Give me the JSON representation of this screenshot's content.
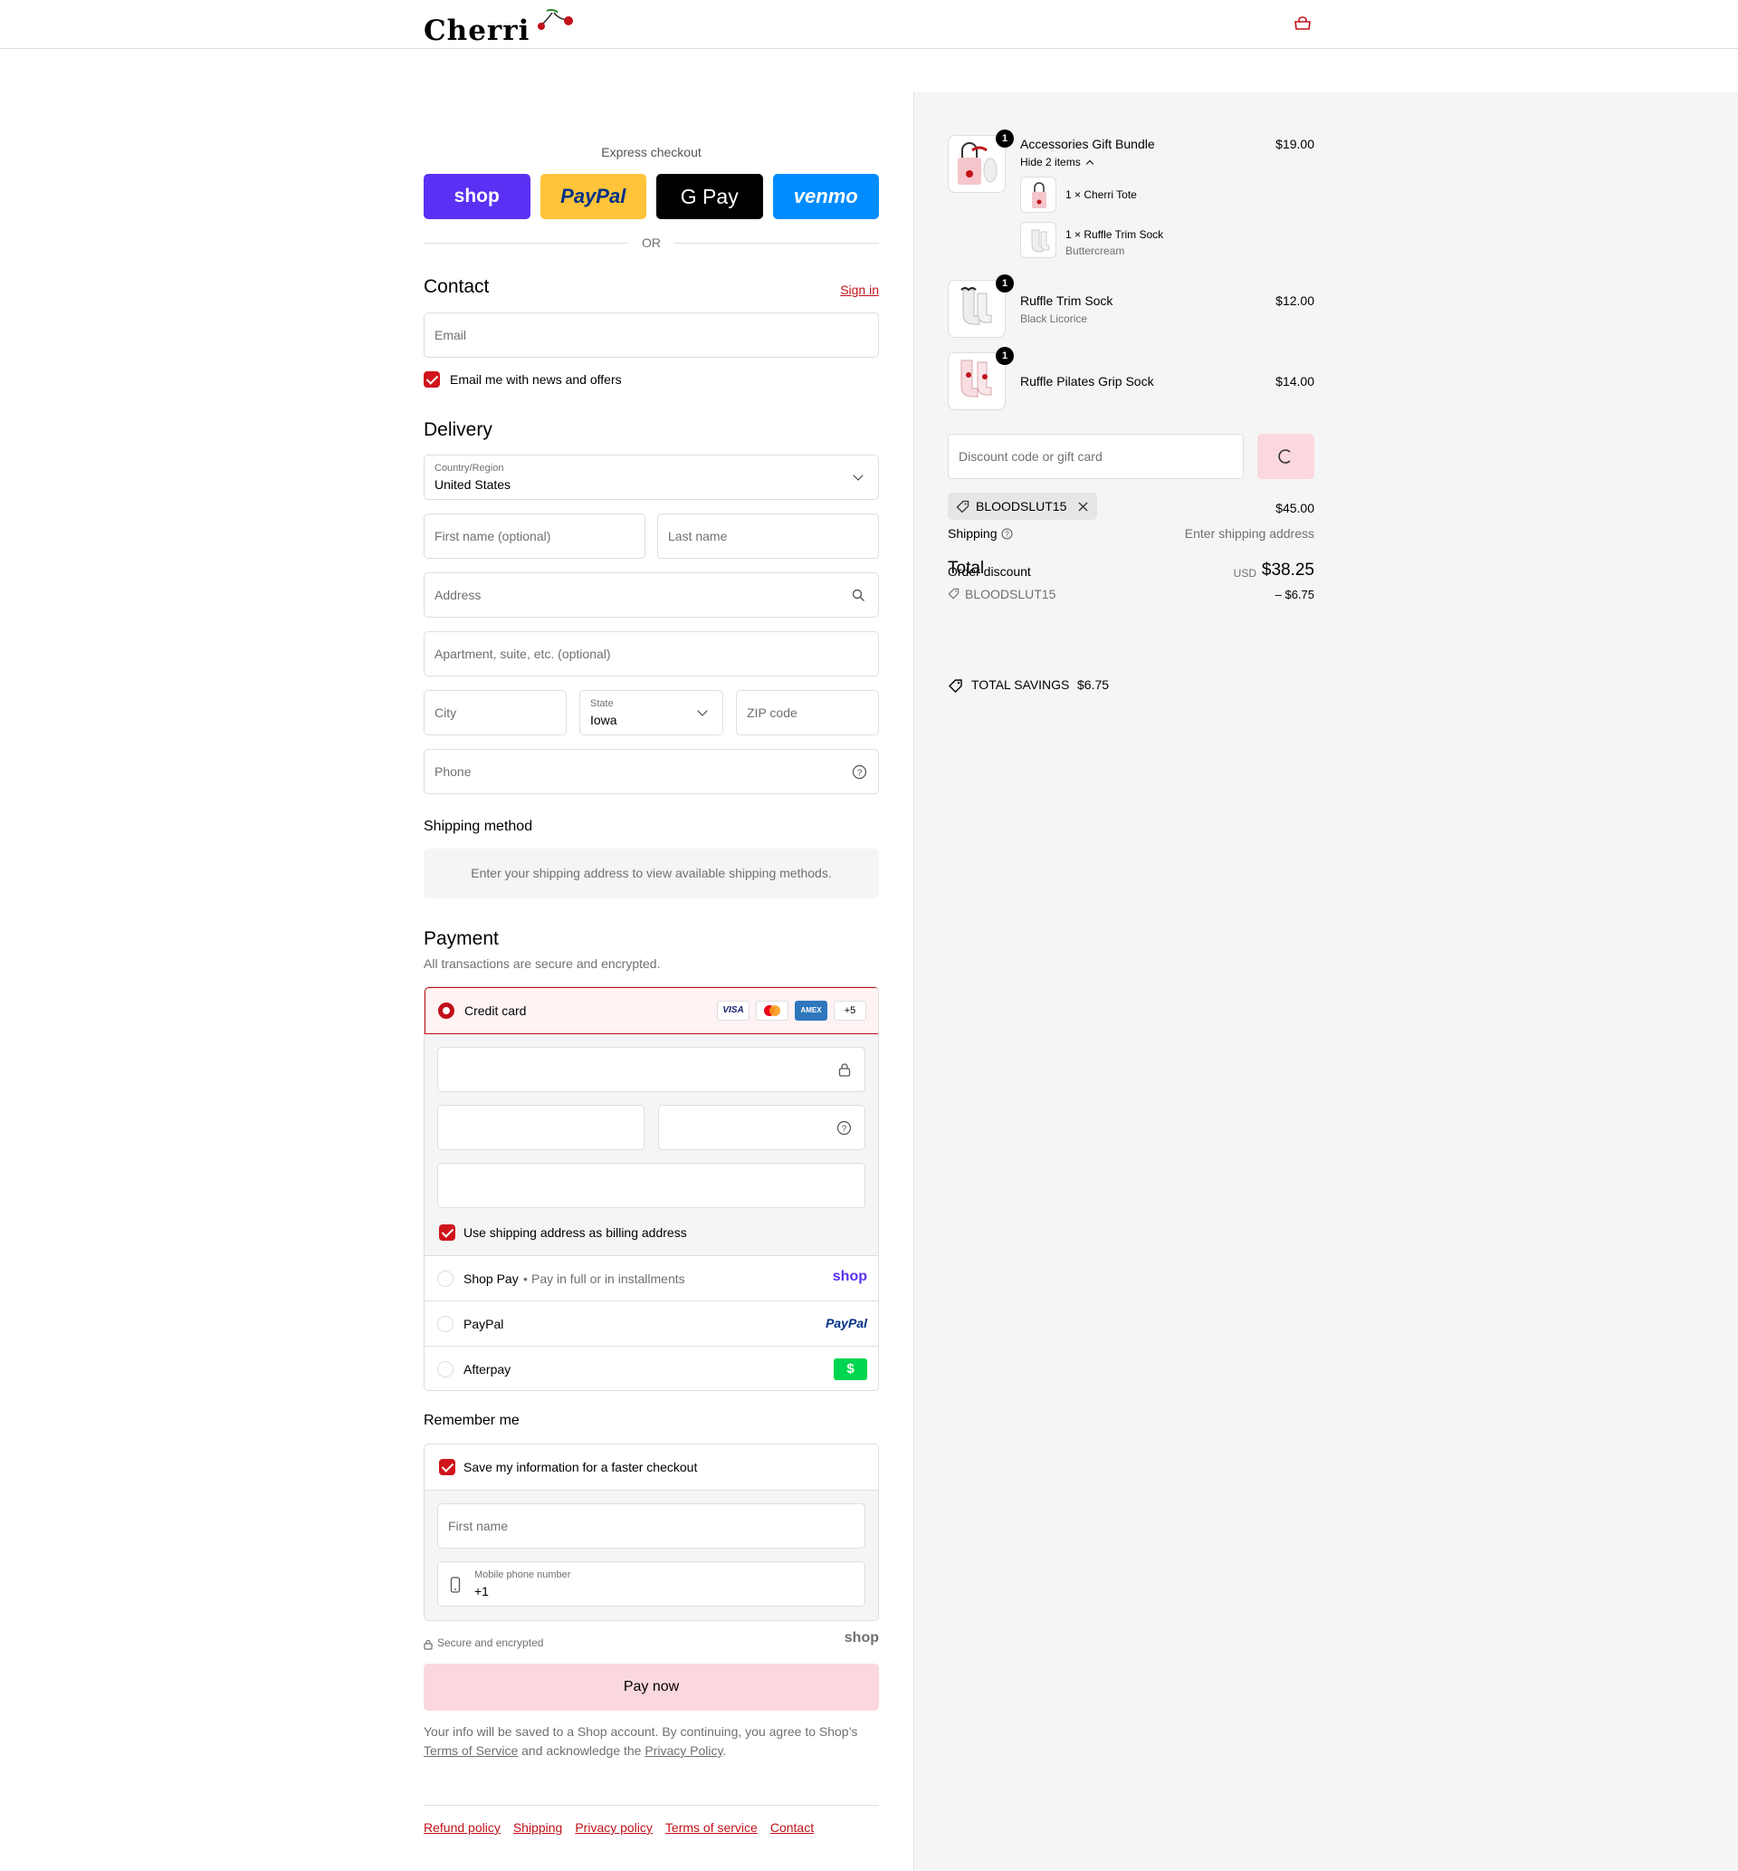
{
  "header": {
    "logo_text": "Cherri",
    "cart_icon": "bag-icon"
  },
  "express": {
    "title": "Express checkout",
    "shop_label": "shop",
    "paypal_label": "PayPal",
    "gpay_label": "G Pay",
    "venmo_label": "venmo",
    "or_text": "OR"
  },
  "contact": {
    "heading": "Contact",
    "sign_in": "Sign in",
    "email_placeholder": "Email",
    "news_label": "Email me with news and offers"
  },
  "delivery": {
    "heading": "Delivery",
    "country_label": "Country/Region",
    "country_value": "United States",
    "first_name_placeholder": "First name (optional)",
    "last_name_placeholder": "Last name",
    "address_placeholder": "Address",
    "apartment_placeholder": "Apartment, suite, etc. (optional)",
    "city_placeholder": "City",
    "state_label": "State",
    "state_value": "Iowa",
    "zip_placeholder": "ZIP code",
    "phone_placeholder": "Phone"
  },
  "shipping_method": {
    "heading": "Shipping method",
    "notice": "Enter your shipping address to view available shipping methods."
  },
  "payment": {
    "heading": "Payment",
    "subtitle": "All transactions are secure and encrypted.",
    "credit_card_label": "Credit card",
    "card_brands": [
      "VISA",
      "MC",
      "AMEX"
    ],
    "more_cards": "+5",
    "billing_label": "Use shipping address as billing address",
    "shop_pay_label": "Shop Pay",
    "shop_pay_sub": "Pay in full or in installments",
    "shop_pay_logo": "shop",
    "paypal_label": "PayPal",
    "paypal_logo": "PayPal",
    "afterpay_label": "Afterpay",
    "afterpay_logo": "$"
  },
  "remember": {
    "heading": "Remember me",
    "save_label": "Save my information for a faster checkout",
    "first_name_placeholder": "First name",
    "mobile_label": "Mobile phone number",
    "mobile_value": "+1",
    "secure_text": "Secure and encrypted",
    "shop_logo": "shop"
  },
  "pay_now": "Pay now",
  "legal": {
    "part1": "Your info will be saved to a Shop account. By continuing, you agree to Shop’s",
    "terms": "Terms of Service",
    "part2": "and acknowledge the",
    "privacy": "Privacy Policy",
    "part3": "."
  },
  "footer": {
    "links": [
      "Refund policy",
      "Shipping",
      "Privacy policy",
      "Terms of service",
      "Contact"
    ]
  },
  "summary": {
    "items": [
      {
        "qty": "1",
        "name": "Accessories Gift Bundle",
        "price": "$19.00",
        "toggle": "Hide 2 items"
      },
      {
        "qty": "1",
        "name": "Ruffle Trim Sock",
        "variant": "Black Licorice",
        "price": "$12.00"
      },
      {
        "qty": "1",
        "name": "Ruffle Pilates Grip Sock",
        "price": "$14.00"
      }
    ],
    "bundle_items": [
      {
        "line": "1 × Cherri Tote"
      },
      {
        "line": "1 × Ruffle Trim Sock",
        "variant": "Buttercream"
      }
    ],
    "discount_placeholder": "Discount code or gift card",
    "applied_code": "BLOODSLUT15",
    "subtotal_value": "$45.00",
    "shipping_label": "Shipping",
    "shipping_value": "Enter shipping address",
    "order_discount_label": "Order discount",
    "discount_code": "BLOODSLUT15",
    "discount_value": "– $6.75",
    "total_label": "Total",
    "currency": "USD",
    "total_value": "$38.25",
    "savings_label": "TOTAL SAVINGS",
    "savings_value": "$6.75"
  },
  "colors": {
    "accent": "#c11119",
    "checkbox": "#d0141c",
    "pay_button": "#fbd8dd",
    "shop_purple": "#5a31f4",
    "paypal_yellow": "#ffc439",
    "venmo_blue": "#008cff",
    "summary_bg": "#f5f5f5"
  }
}
